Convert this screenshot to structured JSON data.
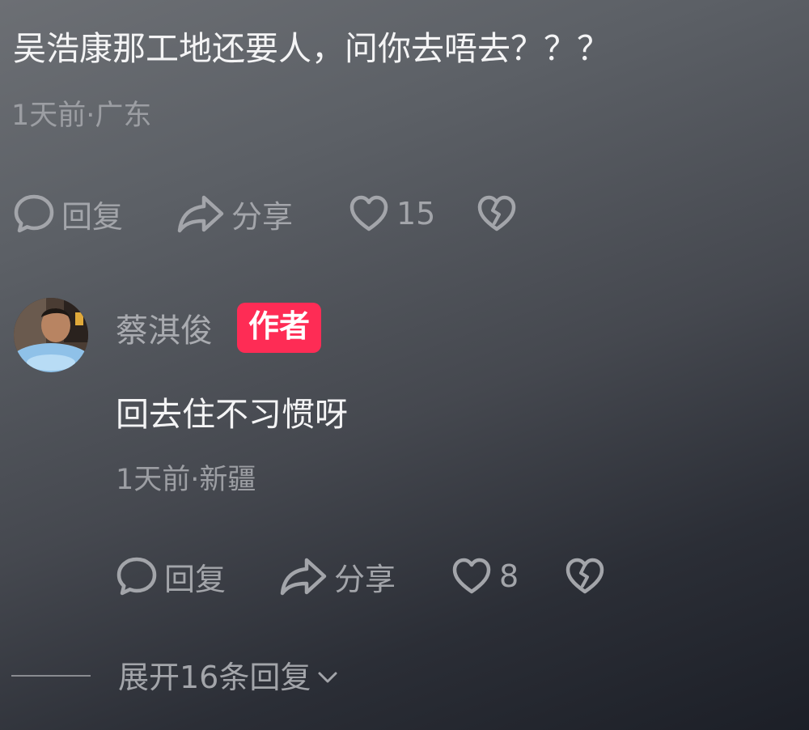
{
  "parent_comment": {
    "text": "吴浩康那工地还要人，问你去唔去？？？",
    "meta": "1天前·广东",
    "actions": {
      "reply_label": "回复",
      "share_label": "分享",
      "like_count": "15"
    }
  },
  "author_reply": {
    "username": "蔡淇俊",
    "badge": "作者",
    "text": "回去住不习惯呀",
    "meta": "1天前·新疆",
    "actions": {
      "reply_label": "回复",
      "share_label": "分享",
      "like_count": "8"
    }
  },
  "expand_replies": {
    "label": "展开16条回复"
  },
  "icons": {
    "reply": "comment-bubble-icon",
    "share": "share-arrow-icon",
    "like": "heart-outline-icon",
    "dislike": "broken-heart-icon",
    "expand": "chevron-down-icon"
  },
  "colors": {
    "badge": "#fe2c55",
    "primary_text": "#f4f4f5",
    "secondary_text": "#9c9ea3"
  }
}
